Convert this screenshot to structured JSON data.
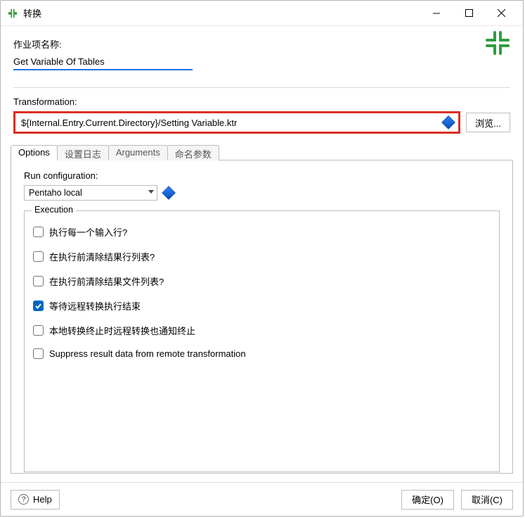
{
  "titlebar": {
    "title": "转换"
  },
  "job": {
    "label": "作业项名称:",
    "name": "Get Variable Of Tables"
  },
  "transformation": {
    "label": "Transformation:",
    "value": "${Internal.Entry.Current.Directory}/Setting Variable.ktr",
    "browse": "浏览..."
  },
  "tabs": {
    "items": [
      {
        "label": "Options",
        "active": true
      },
      {
        "label": "设置日志",
        "active": false
      },
      {
        "label": "Arguments",
        "active": false
      },
      {
        "label": "命名参数",
        "active": false
      }
    ]
  },
  "runconfig": {
    "label": "Run configuration:",
    "value": "Pentaho local"
  },
  "execution": {
    "legend": "Execution",
    "checkboxes": [
      {
        "label": "执行每一个输入行?",
        "checked": false
      },
      {
        "label": "在执行前清除结果行列表?",
        "checked": false
      },
      {
        "label": "在执行前清除结果文件列表?",
        "checked": false
      },
      {
        "label": "等待远程转换执行结束",
        "checked": true
      },
      {
        "label": "本地转换终止时远程转换也通知终止",
        "checked": false
      },
      {
        "label": "Suppress result data from remote transformation",
        "checked": false
      }
    ]
  },
  "buttons": {
    "help": "Help",
    "ok": "确定(O)",
    "cancel": "取消(C)"
  }
}
